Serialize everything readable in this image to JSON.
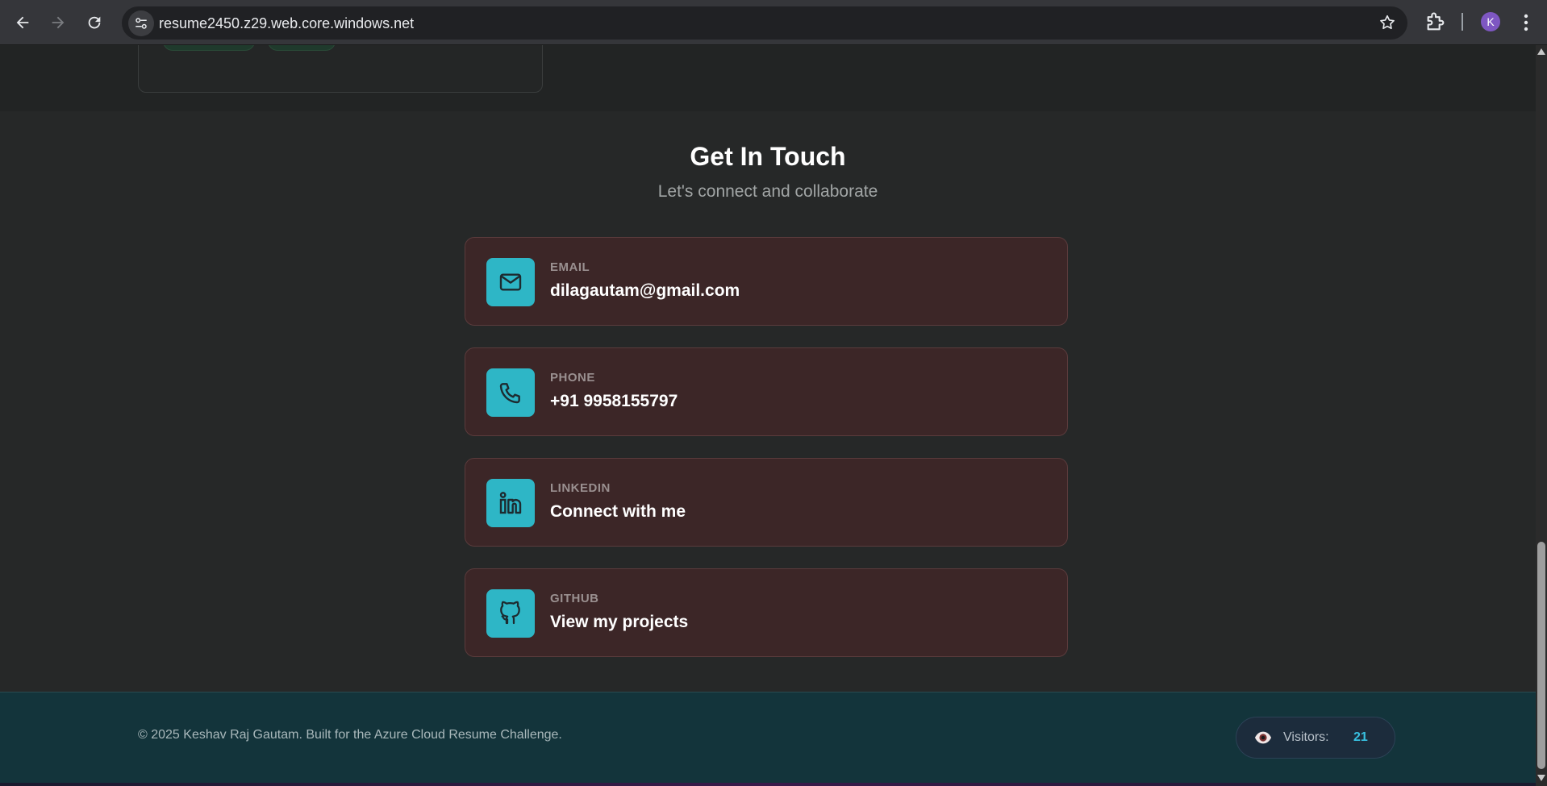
{
  "browser": {
    "url": "resume2450.z29.web.core.windows.net",
    "profile_initial": "K",
    "icons": {
      "back": "arrow-left-icon",
      "forward": "arrow-right-icon",
      "reload": "reload-icon",
      "site_info": "tune-icon",
      "bookmark": "star-icon",
      "extensions": "puzzle-icon",
      "menu": "more-vert-icon"
    }
  },
  "contact": {
    "title": "Get In Touch",
    "subtitle": "Let's connect and collaborate",
    "items": [
      {
        "label": "EMAIL",
        "value": "dilagautam@gmail.com",
        "icon": "mail-icon"
      },
      {
        "label": "PHONE",
        "value": "+91 9958155797",
        "icon": "phone-icon"
      },
      {
        "label": "LINKEDIN",
        "value": "Connect with me",
        "icon": "linkedin-icon"
      },
      {
        "label": "GITHUB",
        "value": "View my projects",
        "icon": "github-icon"
      }
    ]
  },
  "footer": {
    "copyright": "© 2025 Keshav Raj Gautam. Built for the Azure Cloud Resume Challenge.",
    "visitors_label": "Visitors:",
    "visitors_count": "21",
    "visitors_icon": "eye-icon"
  },
  "colors": {
    "accent": "#2eb6c6",
    "card_bg": "#3c2627",
    "footer_bg": "#13343b",
    "visitor_count": "#38c0e0"
  }
}
